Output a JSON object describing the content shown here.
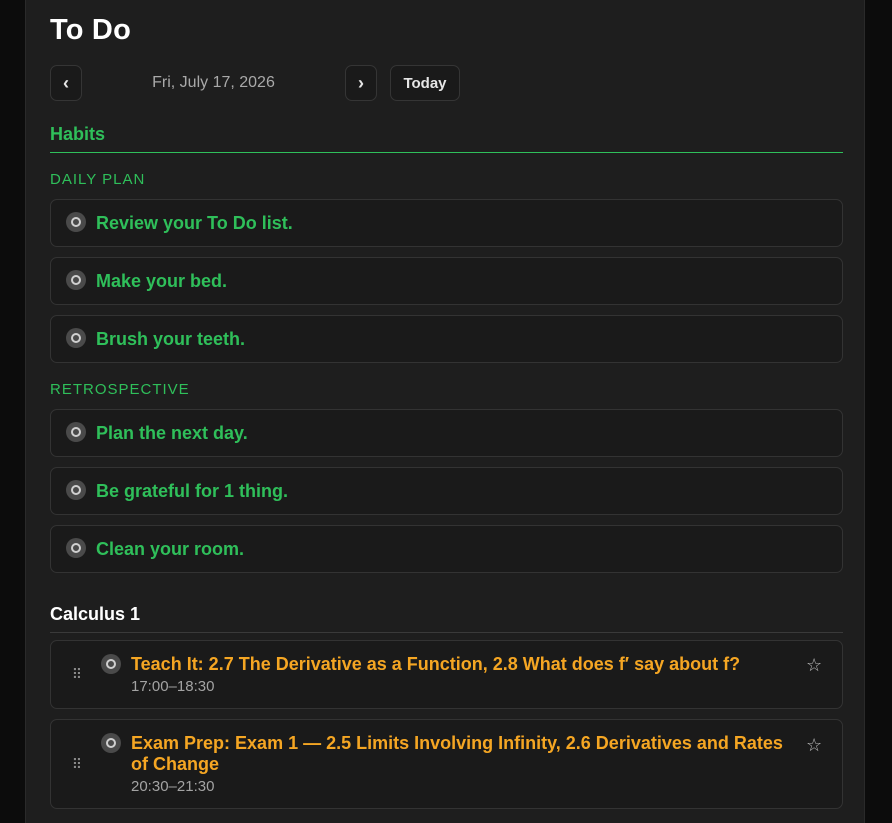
{
  "page": {
    "title": "To Do"
  },
  "date_nav": {
    "prev_label": "‹",
    "next_label": "›",
    "date": "Fri, July 17, 2026",
    "today_label": "Today"
  },
  "habits": {
    "heading": "Habits",
    "color": "#2fbf5a",
    "groups": [
      {
        "label": "DAILY PLAN",
        "items": [
          "Review your To Do list.",
          "Make your bed.",
          "Brush your teeth."
        ]
      },
      {
        "label": "RETROSPECTIVE",
        "items": [
          "Plan the next day.",
          "Be grateful for 1 thing.",
          "Clean your room."
        ]
      }
    ]
  },
  "calculus": {
    "heading": "Calculus 1",
    "accent_color": "#f5a623",
    "tasks": [
      {
        "title": "Teach It: 2.7 The Derivative as a Function, 2.8 What does f′ say about f?",
        "time": "17:00–18:30",
        "starred": false
      },
      {
        "title": "Exam Prep: Exam 1 — 2.5 Limits Involving Infinity, 2.6 Derivatives and Rates of Change",
        "time": "20:30–21:30",
        "starred": false
      }
    ]
  },
  "icons": {
    "check": "circle-check-icon",
    "drag": "drag-handle-icon",
    "star": "star-outline-icon"
  }
}
